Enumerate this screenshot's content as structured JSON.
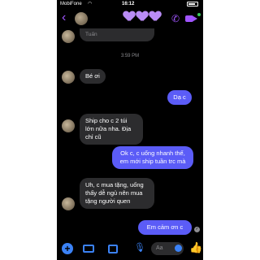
{
  "status_bar": {
    "carrier": "MobiFone",
    "time": "16:12"
  },
  "header": {
    "back_icon": "chevron-left-icon",
    "call_icon": "phone-icon",
    "video_icon": "video-camera-icon",
    "accent": "#a155ff"
  },
  "messages": {
    "partial_top": "Tuấn",
    "timestamp": "3:59 PM",
    "m1": "Bé ơi",
    "m2": "Dạ c",
    "m3": "Ship cho c 2 túi lớn nữa nha. Địa chỉ cũ",
    "m4": "Ok c, c uống nhanh thế, em mới ship tuần trc mà",
    "m5": "Uh, c mua tặng, uống thấy dễ ngủ nên mua tặng người quen",
    "m6": "Em cảm ơn c"
  },
  "composer": {
    "placeholder": "Aa"
  },
  "colors": {
    "outgoing": "#5b5cf7",
    "incoming": "#2c2c2e",
    "composer_icons": "#3b82f6"
  }
}
